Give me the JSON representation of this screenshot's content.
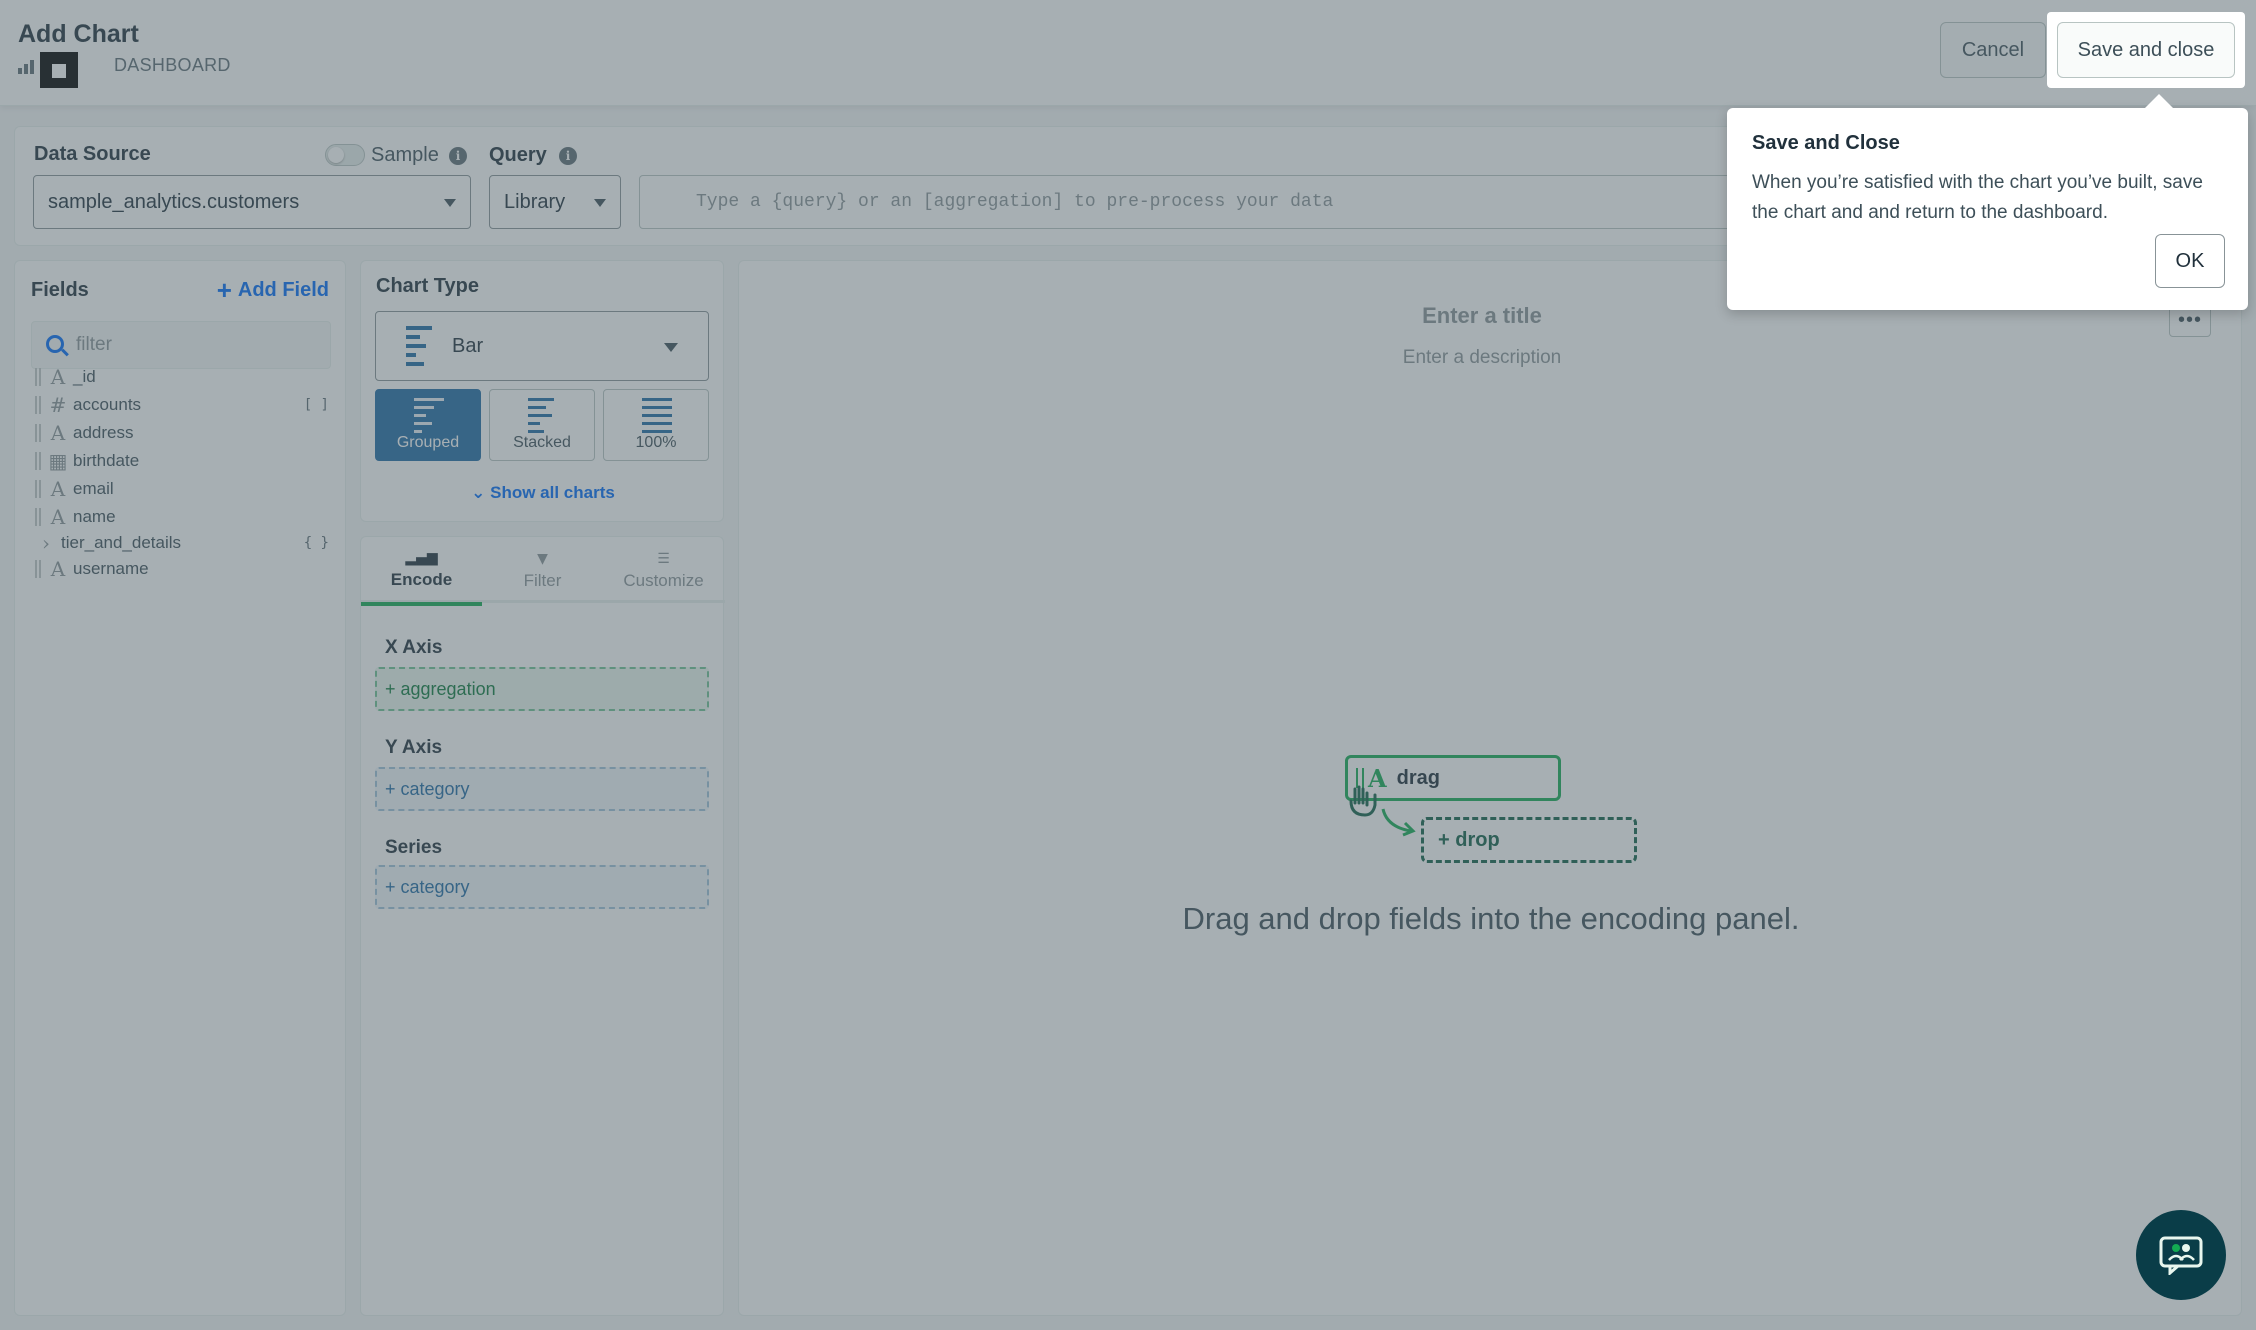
{
  "header": {
    "title": "Add Chart",
    "breadcrumb": "DASHBOARD",
    "cancel_label": "Cancel",
    "save_label": "Save and close"
  },
  "data_source": {
    "label": "Data Source",
    "selected": "sample_analytics.customers",
    "sample_label": "Sample",
    "sample_on": false,
    "query_label": "Query",
    "query_mode": "Library",
    "query_placeholder": "Type a {query} or an [aggregation] to pre-process your data"
  },
  "fields": {
    "title": "Fields",
    "add_label": "Add Field",
    "filter_placeholder": "filter",
    "items": [
      {
        "name": "_id",
        "type": "string-icon",
        "icon": "A",
        "suffix": ""
      },
      {
        "name": "accounts",
        "type": "number-icon",
        "icon": "#",
        "suffix": "[ ]"
      },
      {
        "name": "address",
        "type": "string-icon",
        "icon": "A",
        "suffix": ""
      },
      {
        "name": "birthdate",
        "type": "date-icon",
        "icon": "▦",
        "suffix": ""
      },
      {
        "name": "email",
        "type": "string-icon",
        "icon": "A",
        "suffix": ""
      },
      {
        "name": "name",
        "type": "string-icon",
        "icon": "A",
        "suffix": ""
      },
      {
        "name": "tier_and_details",
        "type": "object",
        "icon": "›",
        "suffix": "{ }"
      },
      {
        "name": "username",
        "type": "string-icon",
        "icon": "A",
        "suffix": ""
      }
    ]
  },
  "chart_type": {
    "title": "Chart Type",
    "selected": "Bar",
    "variants": [
      "Grouped",
      "Stacked",
      "100%"
    ],
    "active_variant": "Grouped",
    "show_all": "Show all charts"
  },
  "encode": {
    "tabs": [
      "Encode",
      "Filter",
      "Customize"
    ],
    "active_tab": "Encode",
    "x_axis_label": "X Axis",
    "x_axis_placeholder": "+ aggregation",
    "y_axis_label": "Y Axis",
    "y_axis_placeholder": "+ category",
    "series_label": "Series",
    "series_placeholder": "+ category"
  },
  "chart_area": {
    "title_placeholder": "Enter a title",
    "desc_placeholder": "Enter a description",
    "more_label": "•••",
    "drag_label": "drag",
    "drop_label": "+ drop",
    "instructions": "Drag and drop fields into the encoding panel."
  },
  "tooltip": {
    "title": "Save and Close",
    "body": "When you’re satisfied with the chart you’ve built, save the chart and and return to the dashboard.",
    "ok_label": "OK"
  },
  "colors": {
    "accent_green": "#13aa52",
    "accent_blue": "#016bf8",
    "chart_blue": "#1f6aa5",
    "chat_bg": "#0a3d48"
  }
}
